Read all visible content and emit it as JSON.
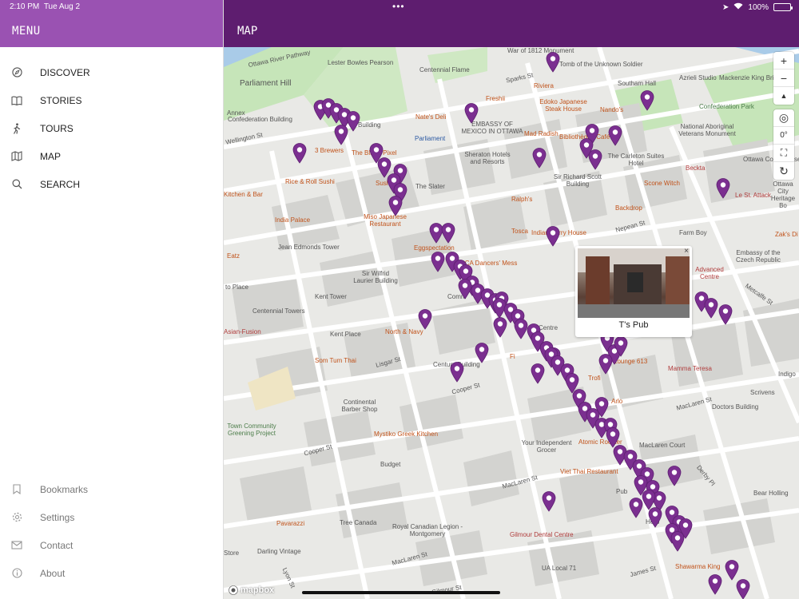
{
  "status": {
    "time": "2:10 PM",
    "date": "Tue Aug 2",
    "battery": "100%"
  },
  "sidebar": {
    "title": "MENU",
    "nav": [
      {
        "label": "DISCOVER",
        "icon": "compass-icon"
      },
      {
        "label": "STORIES",
        "icon": "book-icon"
      },
      {
        "label": "TOURS",
        "icon": "walking-icon"
      },
      {
        "label": "MAP",
        "icon": "map-icon"
      },
      {
        "label": "SEARCH",
        "icon": "search-icon"
      }
    ],
    "secondary": [
      {
        "label": "Bookmarks",
        "icon": "bookmark-icon"
      },
      {
        "label": "Settings",
        "icon": "gear-icon"
      },
      {
        "label": "Contact",
        "icon": "envelope-icon"
      },
      {
        "label": "About",
        "icon": "info-icon"
      }
    ]
  },
  "main": {
    "title": "MAP"
  },
  "map": {
    "controls": {
      "zoom_in": "+",
      "zoom_out": "−",
      "compass": "▲",
      "locate": "◎",
      "bearing": "0°",
      "fullscreen": "⛶",
      "reset": "↻"
    },
    "popup": {
      "name": "T's Pub",
      "close": "×"
    },
    "attribution": "mapbox",
    "labels": {
      "war1812": "War of 1812 Monument",
      "ottawa_river_pkwy": "Ottawa River Pathway",
      "lester": "Lester Bowles Pearson",
      "tomb": "Tomb of the Unknown Soldier",
      "azrieli": "Azrieli Studio",
      "mackenzie": "Mackenzie King Bridge",
      "parliament_hill": "Parliament Hill",
      "centennial_flame": "Centennial Flame",
      "sparks_st": "Sparks St",
      "riviera": "Riviera",
      "edoko": "Edoko Japanese Steak House",
      "nandos": "Nando's",
      "southam": "Southam Hall",
      "annex": "Annex",
      "confed_bldg": "Confederation Building",
      "freshii": "Freshii",
      "nates": "Nate's Deli",
      "embassy": "EMBASSY OF MEXICO IN OTTAWA",
      "confed_park": "Confederation Park",
      "wellington": "Wellington St",
      "building": "Building",
      "parliament_stn": "Parliament",
      "mad_radish": "Mad Radish",
      "biblio": "Bibliothèque Café",
      "nat_abor": "National Aboriginal Veterans Monument",
      "j_brewers": "3 Brewers",
      "blurry": "The Blurry Pixel",
      "sheraton": "Sheraton Hotels and Resorts",
      "carleton": "The Carleton Suites Hotel",
      "ottawa_court": "Ottawa Court House",
      "rice_roll": "Rice & Roll Sushi",
      "sushi_k": "Sushi K",
      "the_slater": "The Slater",
      "sir_richard": "Sir Richard Scott Building",
      "scone": "Scone Witch",
      "beckta": "Beckta",
      "ottawa_city_heritage": "Ottawa City Heritage Bo",
      "kitchen_bar": "Kitchen & Bar",
      "india_palace": "India Palace",
      "miso": "Miso Japanese Restaurant",
      "ralphs": "Ralph's",
      "backdrop": "Backdrop",
      "le_st_attack": "Le St. Attack",
      "jean_edmonds": "Jean Edmonds Tower",
      "tosca": "Tosca",
      "indian_curry": "Indian Curry House",
      "nepean": "Nepean St",
      "farm_boy": "Farm Boy",
      "zaks": "Zak's Di",
      "eatz": "Eatz",
      "eggspectation": "Eggspectation",
      "rca": "RCA Dancers' Mess",
      "embassy_czech": "Embassy of the Czech Republic",
      "sir_wilfrid": "Sir Wilfrid Laurier Building",
      "advanced": "Advanced Centre",
      "to_place": "to Place",
      "kent_tower": "Kent Tower",
      "commons": "Comm",
      "metcalfe": "Metcalfe St",
      "centennial_towers": "Centennial Towers",
      "centre": "Centre",
      "asian_fusion": "Asian-Fusion",
      "kent_place": "Kent Place",
      "north_navy": "North & Navy",
      "fi": "Fi",
      "som_tum": "Som Tum Thai",
      "lisgar": "Lisgar St",
      "century_bldg": "Century Building",
      "trofi": "Trofi",
      "lounge613": "Lounge 613",
      "mamma_teresa": "Mamma Teresa",
      "indigo": "Indigo",
      "arlo": "Arlo",
      "scrivens": "Scrivens",
      "continental": "Continental Barber Shop",
      "cooper_st1": "Cooper St",
      "doctors_bldg": "Doctors Building",
      "community": "Town Community Greening Project",
      "mystiko": "Mystiko Greek Kitchen",
      "maclaren_st1": "MacLaren St",
      "your_indep": "Your Independent Grocer",
      "atomic": "Atomic Rooster",
      "maclaren_court": "MacLaren Court",
      "cooper_st2": "Cooper St",
      "budget": "Budget",
      "viet_thai": "Viet Thai Restaurant",
      "derby": "Derby Pl",
      "bear_holling": "Bear Holling",
      "maclaren_st2": "MacLaren St",
      "pub": "Pub",
      "pavarazzi": "Pavarazzi",
      "tree_canada": "Tree Canada",
      "royal_legion": "Royal Canadian Legion - Montgomery",
      "gilmour": "Gilmour Dental Centre",
      "herbs": "Herb",
      "store": "Store",
      "darling": "Darling Vintage",
      "maclaren_st3": "MacLaren St",
      "lyon": "Lyon St",
      "ua_local": "UA Local 71",
      "james": "James St",
      "shawarma": "Shawarma King",
      "gilmour_st": "Gilmour St"
    }
  }
}
